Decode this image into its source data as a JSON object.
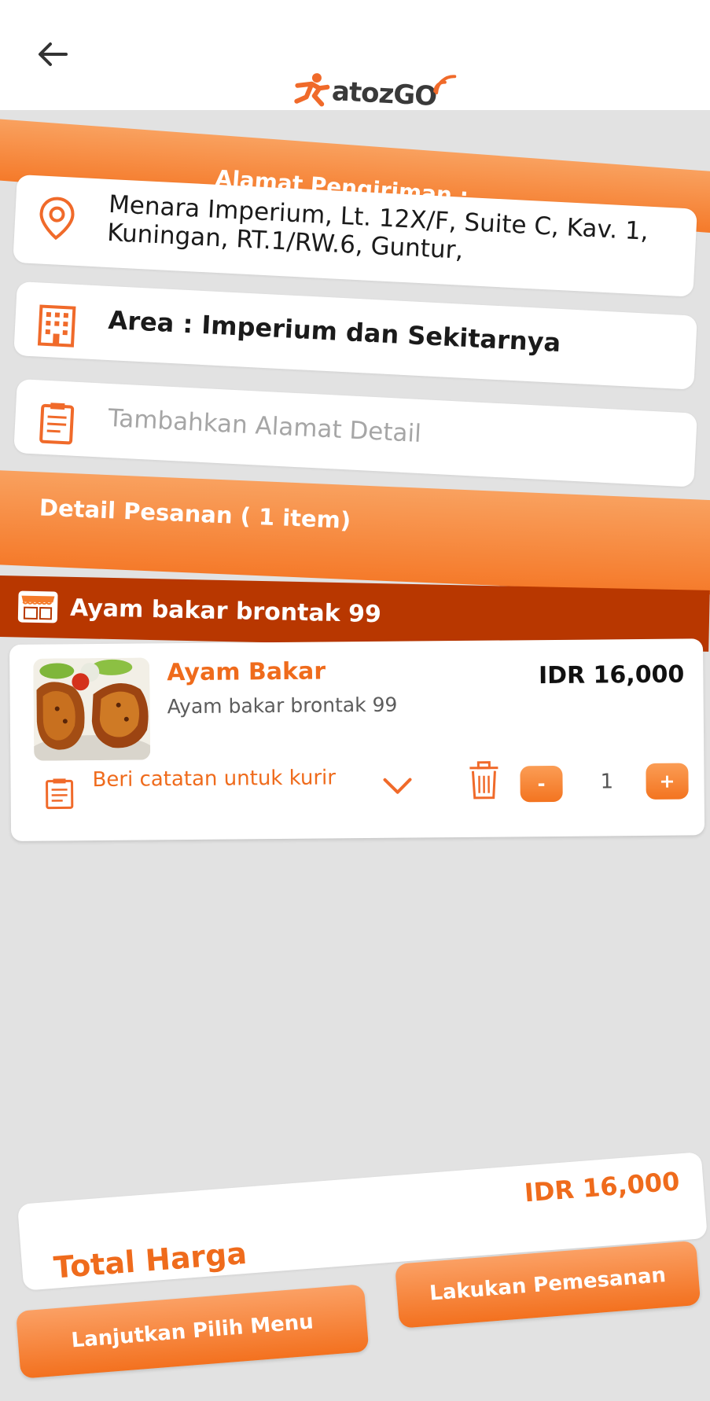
{
  "header": {
    "logo_text_a": "atoz",
    "logo_text_b": "GO"
  },
  "shipping": {
    "heading": "Alamat Pengiriman :",
    "address": "Menara Imperium, Lt. 12X/F, Suite C, Kav. 1, Kuningan, RT.1/RW.6, Guntur,",
    "area": "Area : Imperium dan Sekitarnya",
    "detail_placeholder": "Tambahkan Alamat Detail"
  },
  "order": {
    "heading": "Detail Pesanan ( 1 item)",
    "shop_name": "Ayam bakar brontak 99",
    "items": [
      {
        "title": "Ayam Bakar",
        "subtitle": "Ayam bakar brontak 99",
        "price": "IDR 16,000",
        "note_placeholder": "Beri catatan untuk kurir",
        "quantity": "1",
        "minus_label": "-",
        "plus_label": "+"
      }
    ]
  },
  "summary": {
    "total_label": "Total Harga",
    "total_value": "IDR 16,000",
    "continue_label": "Lanjutkan Pilih Menu",
    "order_label": "Lakukan Pemesanan"
  },
  "colors": {
    "accent": "#f57a2a",
    "shop_bar": "#b83700",
    "background": "#e2e2e2"
  }
}
